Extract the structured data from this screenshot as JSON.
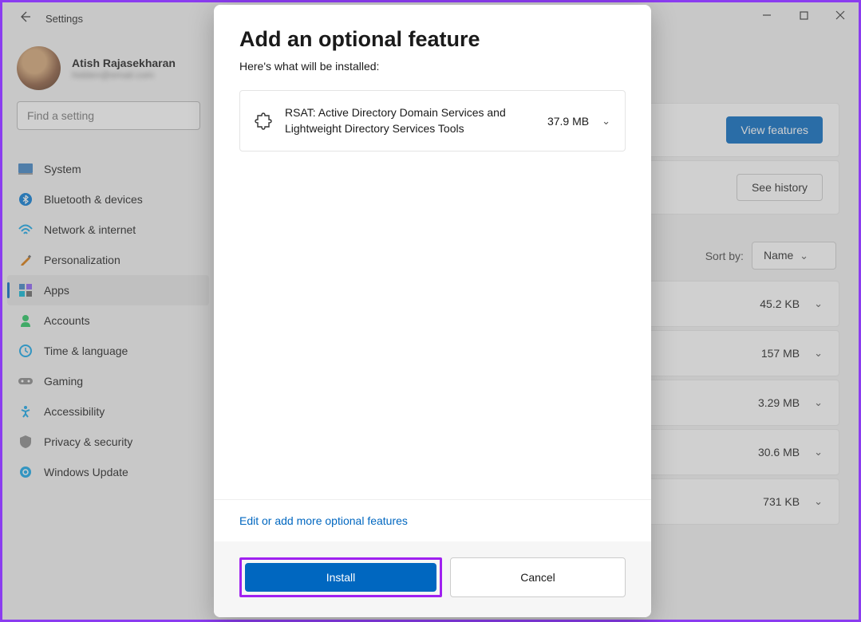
{
  "window": {
    "title": "Settings"
  },
  "profile": {
    "name": "Atish Rajasekharan",
    "email": "hidden@email.com"
  },
  "search": {
    "placeholder": "Find a setting"
  },
  "sidebar": {
    "items": [
      {
        "label": "System"
      },
      {
        "label": "Bluetooth & devices"
      },
      {
        "label": "Network & internet"
      },
      {
        "label": "Personalization"
      },
      {
        "label": "Apps"
      },
      {
        "label": "Accounts"
      },
      {
        "label": "Time & language"
      },
      {
        "label": "Gaming"
      },
      {
        "label": "Accessibility"
      },
      {
        "label": "Privacy & security"
      },
      {
        "label": "Windows Update"
      }
    ]
  },
  "content": {
    "view_features": "View features",
    "see_history": "See history",
    "sort_label": "Sort by:",
    "sort_value": "Name",
    "rows": [
      {
        "size": "45.2 KB"
      },
      {
        "size": "157 MB"
      },
      {
        "size": "3.29 MB"
      },
      {
        "size": "30.6 MB"
      },
      {
        "size": "731 KB"
      }
    ]
  },
  "modal": {
    "title": "Add an optional feature",
    "subtitle": "Here's what will be installed:",
    "feature": {
      "name": "RSAT: Active Directory Domain Services and Lightweight Directory Services Tools",
      "size": "37.9 MB"
    },
    "edit_link": "Edit or add more optional features",
    "install": "Install",
    "cancel": "Cancel"
  }
}
